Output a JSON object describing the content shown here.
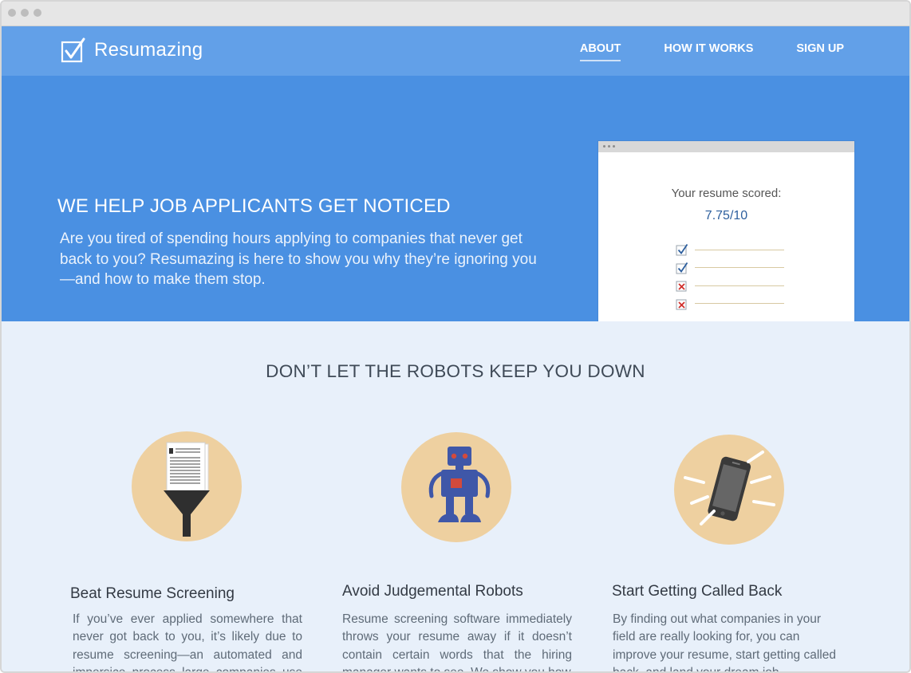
{
  "nav": {
    "brand": "Resumazing",
    "links": [
      {
        "label": "ABOUT",
        "active": true
      },
      {
        "label": "HOW IT WORKS",
        "active": false
      },
      {
        "label": "SIGN UP",
        "active": false
      }
    ]
  },
  "hero": {
    "title": "WE HELP JOB APPLICANTS GET NOTICED",
    "text": "Are you tired of spending hours applying to companies that never get back to you? Resumazing is here to show you why they’re ignoring you—and how to make them stop.",
    "card": {
      "label": "Your resume scored:",
      "score": "7.75/10",
      "checks": [
        "check",
        "check",
        "cross",
        "cross"
      ]
    }
  },
  "section": {
    "title": "DON’T LET THE ROBOTS KEEP YOU DOWN",
    "features": [
      {
        "icon": "resume-funnel-icon",
        "title": "Beat Resume Screening",
        "text": "If you’ve ever applied somewhere that never got back to you, it’s likely due to resume screening—an automated and impersice process large companies use to"
      },
      {
        "icon": "robot-icon",
        "title": "Avoid Judgemental Robots",
        "text": "Resume screening software immediately throws your resume away if it doesn’t contain certain words that the hiring manager wants to see. We show you how"
      },
      {
        "icon": "ringing-phone-icon",
        "title": "Start Getting Called Back",
        "text": "By finding out what companies in your field are really looking for, you can improve your resume, start getting called back, and land your dream job."
      }
    ]
  },
  "colors": {
    "nav": "#62a0e8",
    "hero": "#4a90e2",
    "section": "#e8f0fa",
    "icon_bg": "#eed0a0",
    "score": "#2d5f9e"
  }
}
